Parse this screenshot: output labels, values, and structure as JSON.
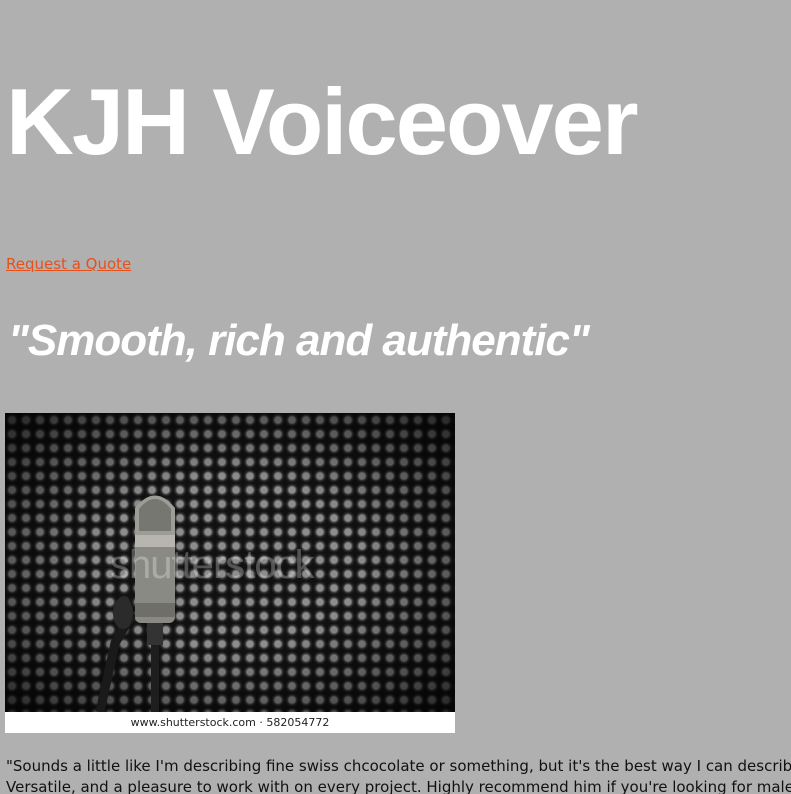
{
  "header": {
    "site_title": "KJH Voiceover"
  },
  "nav": {
    "request_quote_label": "Request a Quote"
  },
  "hero": {
    "tagline": "\"Smooth, rich and authentic\"",
    "image": {
      "watermark_text": "shutterstock",
      "caption_site": "www.shutterstock.com",
      "caption_separator": "·",
      "caption_id": "582054772"
    }
  },
  "testimonial": {
    "text": "\"Sounds a little like I'm describing fine swiss chcocolate or something, but it's the best way I can describe KJH's voice. Versatile, and a pleasure to work with on every project. Highly recommend him if you're looking for male voiceover talent.\""
  },
  "colors": {
    "background": "#b0b0b0",
    "title": "#ffffff",
    "link": "#e8501a"
  }
}
